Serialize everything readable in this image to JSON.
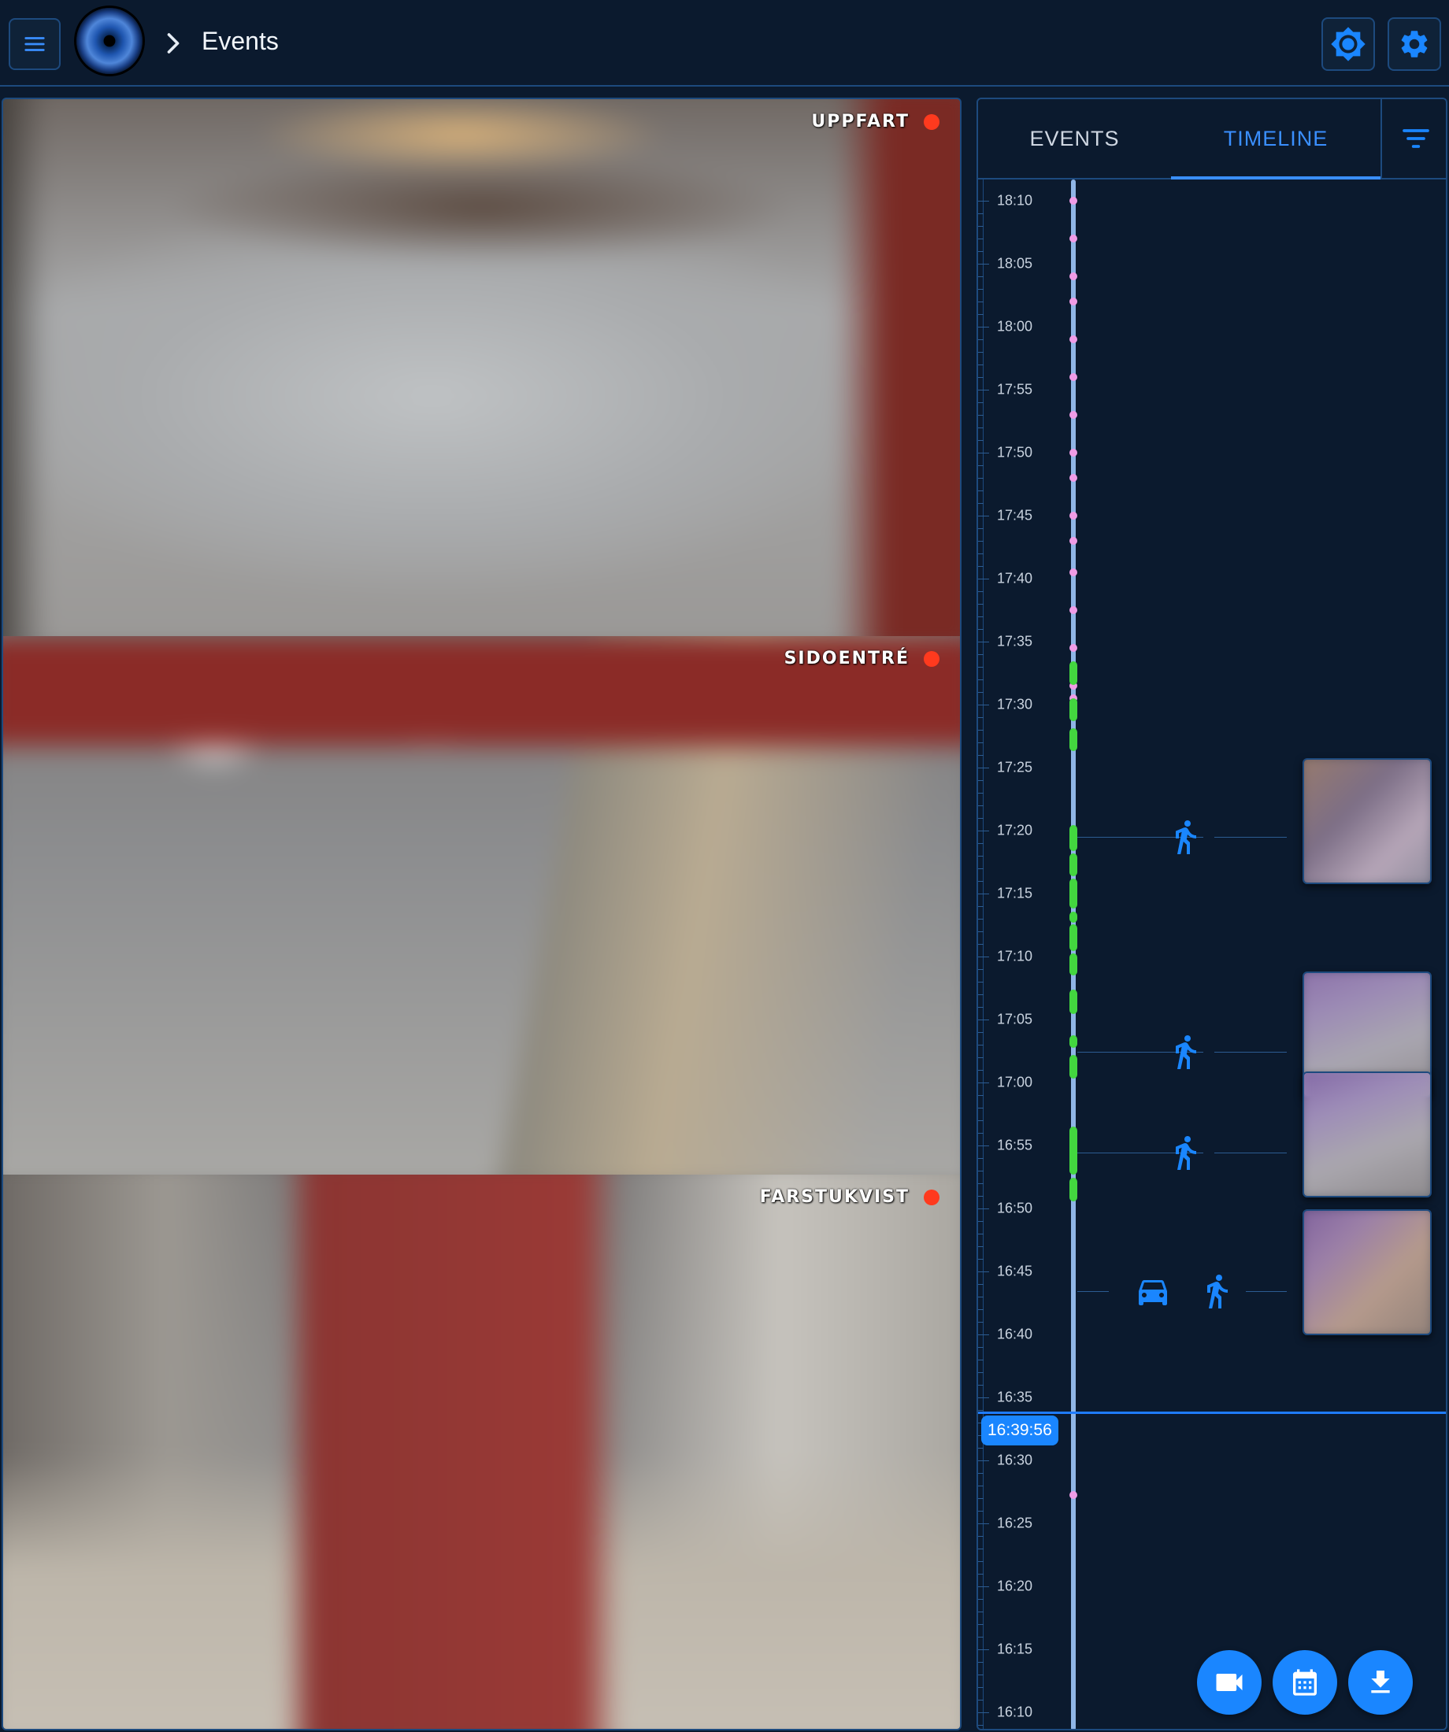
{
  "header": {
    "title": "Events",
    "icons": {
      "menu": "menu-icon",
      "logo": "eye-iris-logo",
      "breadcrumb_separator": "chevron-right-icon",
      "brightness": "brightness-icon",
      "settings": "gear-icon"
    }
  },
  "cameras": [
    {
      "name": "UPPFART",
      "status": "recording"
    },
    {
      "name": "SIDOENTRÉ",
      "status": "recording"
    },
    {
      "name": "FARSTUKVIST",
      "status": "recording"
    }
  ],
  "tabs": [
    {
      "label": "EVENTS",
      "active": false
    },
    {
      "label": "TIMELINE",
      "active": true
    }
  ],
  "filter_icon": "filter-icon",
  "timeline": {
    "labels": [
      "18:10",
      "18:05",
      "18:00",
      "17:55",
      "17:50",
      "17:45",
      "17:40",
      "17:35",
      "17:30",
      "17:25",
      "17:20",
      "17:15",
      "17:10",
      "17:05",
      "17:00",
      "16:55",
      "16:50",
      "16:45",
      "16:40",
      "16:35",
      "16:30",
      "16:25",
      "16:20",
      "16:15",
      "16:10"
    ],
    "current_time": "16:39:56",
    "events": [
      {
        "time": "17:27",
        "objects": [
          "person"
        ]
      },
      {
        "time": "17:10",
        "objects": [
          "person"
        ]
      },
      {
        "time": "17:02",
        "objects": [
          "person"
        ]
      },
      {
        "time": "16:51",
        "objects": [
          "car",
          "person"
        ]
      }
    ]
  },
  "actions": [
    {
      "name": "camera",
      "icon": "video-camera-icon"
    },
    {
      "name": "calendar",
      "icon": "calendar-icon"
    },
    {
      "name": "download",
      "icon": "download-icon"
    }
  ],
  "colors": {
    "background": "#0b1a2e",
    "border": "#1d4a7e",
    "accent": "#1a86ff",
    "active_tab": "#3a8fff",
    "recording_dot": "#ff3a1e",
    "motion_dot": "#f09ce6",
    "object_segment": "#43d63f"
  }
}
